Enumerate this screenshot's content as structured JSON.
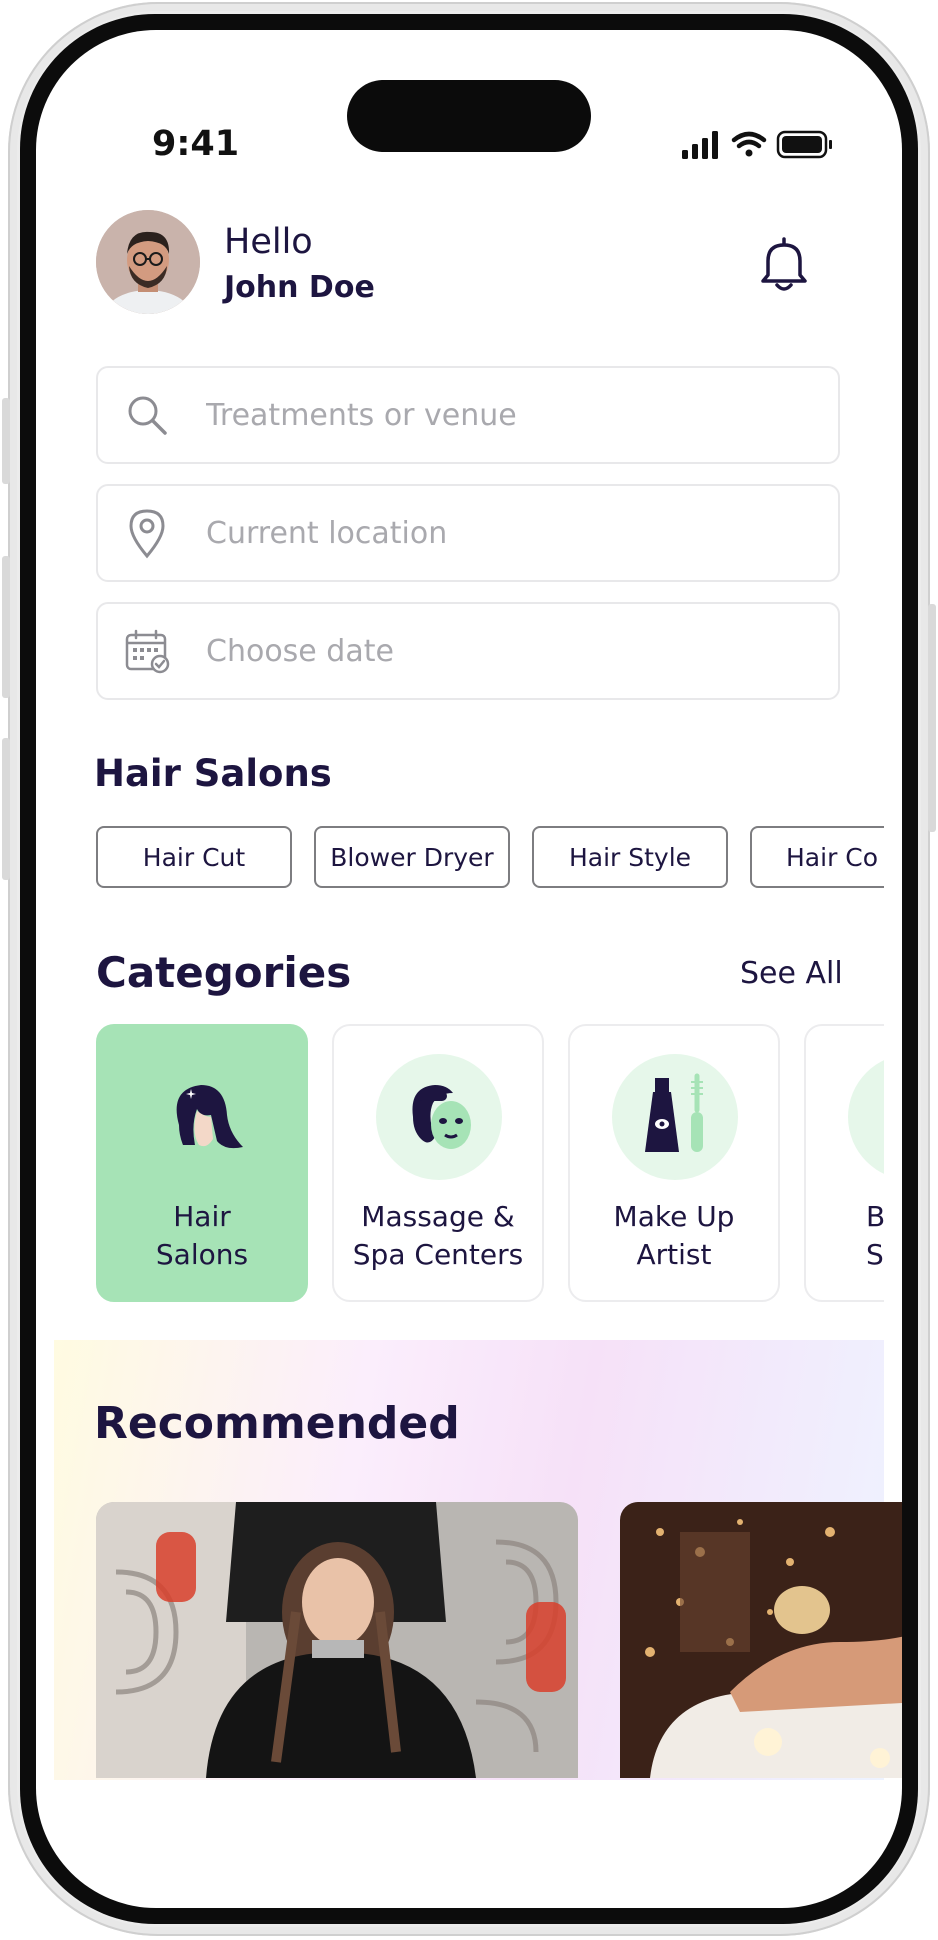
{
  "status": {
    "time": "9:41"
  },
  "header": {
    "greeting": "Hello",
    "user_name": "John Doe"
  },
  "search": {
    "placeholder": "Treatments or venue"
  },
  "location": {
    "placeholder": "Current location"
  },
  "date": {
    "placeholder": "Choose date"
  },
  "hair_salons": {
    "title": "Hair Salons",
    "chips": [
      "Hair Cut",
      "Blower Dryer",
      "Hair Style",
      "Hair Co"
    ]
  },
  "categories": {
    "title": "Categories",
    "see_all": "See All",
    "items": [
      {
        "label": "Hair\nSalons",
        "icon": "woman-hair-icon",
        "active": true
      },
      {
        "label": "Massage &\nSpa Centers",
        "icon": "face-mask-icon",
        "active": false
      },
      {
        "label": "Make Up\nArtist",
        "icon": "makeup-icon",
        "active": false
      },
      {
        "label": "B\nS",
        "icon": "beauty-icon",
        "active": false
      }
    ]
  },
  "recommended": {
    "title": "Recommended",
    "cards": [
      {
        "image": "hair-salon-photo"
      },
      {
        "image": "spa-massage-photo"
      }
    ]
  },
  "colors": {
    "text": "#1d1540",
    "accent_green": "#a6e3b6",
    "light_green": "#e6f7ea"
  }
}
